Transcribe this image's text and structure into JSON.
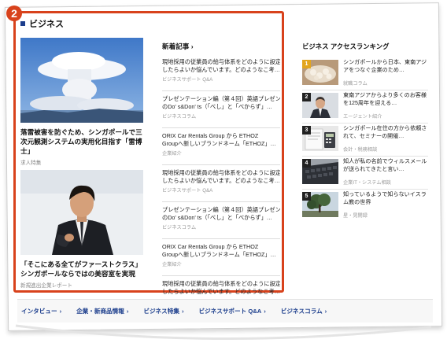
{
  "highlight": {
    "badge": "2"
  },
  "section": {
    "title": "ビジネス"
  },
  "featured": [
    {
      "title": "落雷被害を防ぐため、シンガポールで三次元観測システムの実用化目指す「雷博士」",
      "category": "求人特集",
      "image": "storm-cloud-photo"
    },
    {
      "title": "「そこにある全てがファーストクラス」シンガポールならではの美容室を実現",
      "category": "新規進出企業レポート",
      "image": "man-in-suit-photo"
    }
  ],
  "news": {
    "heading": "新着記事",
    "chevron": "›",
    "items": [
      {
        "title1": "現地採用の従業員の給与体系をどのように設定",
        "title2": "したらよいか悩んでいます。どのようなこ考…",
        "category": "ビジネスサポート Q&A"
      },
      {
        "title1": "プレゼンテーション編（第４回）英語プレゼン",
        "title2": "のDo' s&Don' ts（「べし」と「べからず」…",
        "category": "ビジネスコラム"
      },
      {
        "title1": "ORIX Car Rentals Group から ETHOZ",
        "title2": "Groupへ新しいブランドネーム「ETHOZ」…",
        "category": "企業紹介"
      },
      {
        "title1": "現地採用の従業員の給与体系をどのように設定",
        "title2": "したらよいか悩んでいます。どのようなこ考…",
        "category": "ビジネスサポート Q&A"
      },
      {
        "title1": "プレゼンテーション編（第４回）英語プレゼン",
        "title2": "のDo' s&Don' ts（「べし」と「べからず」…",
        "category": "ビジネスコラム"
      },
      {
        "title1": "ORIX Car Rentals Group から ETHOZ",
        "title2": "Groupへ新しいブランドネーム「ETHOZ」…",
        "category": "企業紹介"
      },
      {
        "title1": "現地採用の従業員の給与体系をどのように設定",
        "title2": "したらよいか悩んでいます。どのようなこ考…",
        "category": ""
      }
    ]
  },
  "ranking": {
    "heading": "ビジネス アクセスランキング",
    "items": [
      {
        "rank": "1",
        "title": "シンガポールから日本、東南アジアをつなぐ企業のため…",
        "category": "就職コラム",
        "image": "food-dish-photo"
      },
      {
        "rank": "2",
        "title": "東南アジアからより多くのお客様を125周年を迎える…",
        "category": "エージェント紹介",
        "image": "businessman-photo"
      },
      {
        "rank": "3",
        "title": "シンガポール在住の方から依頼されて、セミナーの開催…",
        "category": "会計・税務相談",
        "image": "calculator-photo"
      },
      {
        "rank": "4",
        "title": "知人が私の名前でウィルスメールが送られてきたと言い…",
        "category": "企業IT・システム相談",
        "image": "keyboard-photo"
      },
      {
        "rank": "5",
        "title": "知っているようで知らないイスラム教の世界",
        "category": "星・晃開録",
        "image": "tree-photo"
      }
    ]
  },
  "footer": {
    "links": [
      {
        "label": "インタビュー"
      },
      {
        "label": "企業・新商品情報"
      },
      {
        "label": "ビジネス特集"
      },
      {
        "label": "ビジネスサポート Q&A"
      },
      {
        "label": "ビジネスコラム"
      }
    ],
    "chevron": "›"
  },
  "colors": {
    "accent": "#d8421c",
    "brand": "#1b3d8c",
    "rank1": "#e3a51c"
  }
}
